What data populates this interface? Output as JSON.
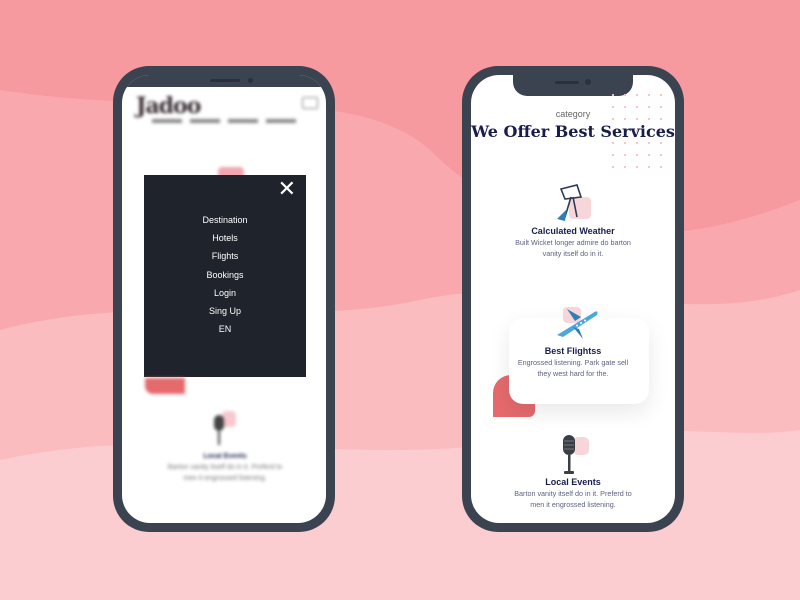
{
  "colors": {
    "background": "#f79aa0",
    "phone_frame": "#3b4350",
    "menu_bg": "#1e232c",
    "heading": "#181e4b",
    "accent": "#e56a6d"
  },
  "left_phone": {
    "logo": "Jadoo",
    "menu": {
      "close_icon": "close-icon",
      "items": [
        "Destination",
        "Hotels",
        "Flights",
        "Bookings",
        "Login",
        "Sing Up",
        "EN"
      ]
    },
    "bg_service": {
      "title": "Local Events",
      "description": "Barton vanity itself do in it. Preferd to men it engrossed listening."
    }
  },
  "right_phone": {
    "category": "category",
    "heading": "We Offer Best Services",
    "services": [
      {
        "icon": "satellite-icon",
        "title": "Calculated Weather",
        "description": "Built Wicket longer admire do barton vanity itself do in it."
      },
      {
        "icon": "plane-icon",
        "title": "Best Flightss",
        "description": "Engrossed listening. Park gate sell they west hard for the."
      },
      {
        "icon": "microphone-icon",
        "title": "Local Events",
        "description": "Barton vanity itself do in it. Preferd to men it engrossed listening."
      }
    ]
  }
}
